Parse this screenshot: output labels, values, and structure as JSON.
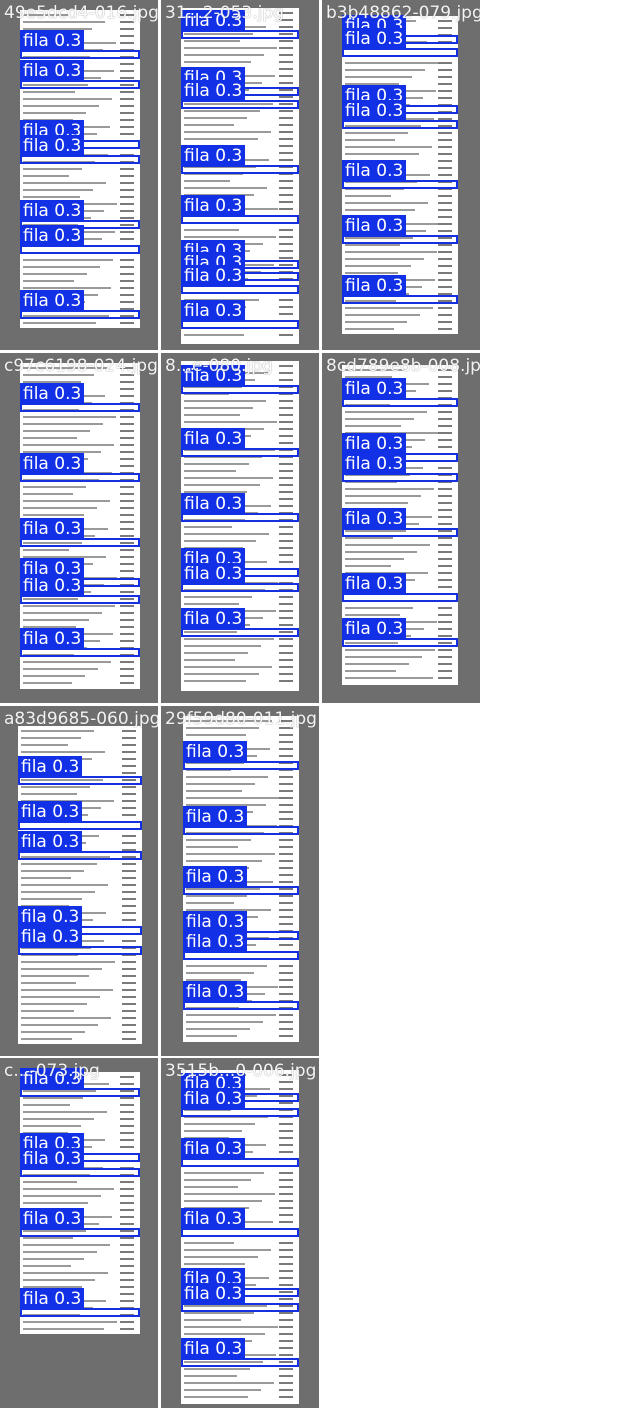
{
  "grid": {
    "background": "#6e6e6e",
    "box_color": "#1430e0",
    "label_color": "#1230e6",
    "tiles": [
      {
        "title": "49e5dcd4-016.jpg",
        "detections": [
          {
            "label": "fila 0.3"
          },
          {
            "label": "fila 0.3"
          },
          {
            "label": "fila 0.3"
          },
          {
            "label": "fila 0.3"
          },
          {
            "label": "fila 0.3"
          },
          {
            "label": "fila 0.3"
          },
          {
            "label": "fila 0.3"
          }
        ]
      },
      {
        "title": "31...2-053.jpg",
        "detections": [
          {
            "label": "fila 0.3"
          },
          {
            "label": "fila 0.3"
          },
          {
            "label": "fila 0.3"
          },
          {
            "label": "fila 0.3"
          },
          {
            "label": "fila 0.3"
          },
          {
            "label": "fila 0.3"
          },
          {
            "label": "fila 0.3"
          },
          {
            "label": "fila 0.3"
          },
          {
            "label": "fila 0.3"
          }
        ]
      },
      {
        "title": "b3b48862-079.jpg",
        "detections": [
          {
            "label": "fila 0.3"
          },
          {
            "label": "fila 0.3"
          },
          {
            "label": "fila 0.3"
          },
          {
            "label": "fila 0.3"
          },
          {
            "label": "fila 0.3"
          },
          {
            "label": "fila 0.3"
          },
          {
            "label": "fila 0.3"
          }
        ]
      },
      {
        "title": "c97c6198-024.jpg",
        "detections": [
          {
            "label": "fila 0.3"
          },
          {
            "label": "fila 0.3"
          },
          {
            "label": "fila 0.3"
          },
          {
            "label": "fila 0.3"
          },
          {
            "label": "fila 0.3"
          },
          {
            "label": "fila 0.3"
          }
        ]
      },
      {
        "title": "8...e-080.jpg",
        "detections": [
          {
            "label": "fila 0.3"
          },
          {
            "label": "fila 0.3"
          },
          {
            "label": "fila 0.3"
          },
          {
            "label": "fila 0.3"
          },
          {
            "label": "fila 0.3"
          },
          {
            "label": "fila 0.3"
          }
        ]
      },
      {
        "title": "8cd789e8b-008.jpg",
        "detections": [
          {
            "label": "fila 0.3"
          },
          {
            "label": "fila 0.3"
          },
          {
            "label": "fila 0.3"
          },
          {
            "label": "fila 0.3"
          },
          {
            "label": "fila 0.3"
          },
          {
            "label": "fila 0.3"
          }
        ]
      },
      {
        "title": "a83d9685-060.jpg",
        "detections": [
          {
            "label": "fila 0.3"
          },
          {
            "label": "fila 0.3"
          },
          {
            "label": "fila 0.3"
          },
          {
            "label": "fila 0.3"
          },
          {
            "label": "fila 0.3"
          }
        ]
      },
      {
        "title": "29f59d80-011.jpg",
        "detections": [
          {
            "label": "fila 0.3"
          },
          {
            "label": "fila 0.3"
          },
          {
            "label": "fila 0.3"
          },
          {
            "label": "fila 0.3"
          },
          {
            "label": "fila 0.3"
          },
          {
            "label": "fila 0.3"
          }
        ]
      },
      {
        "title": "c...-073.jpg",
        "detections": [
          {
            "label": "fila 0.3"
          },
          {
            "label": "fila 0.3"
          },
          {
            "label": "fila 0.3"
          },
          {
            "label": "fila 0.3"
          },
          {
            "label": "fila 0.3"
          }
        ]
      },
      {
        "title": "3515b...0-006.jpg",
        "detections": [
          {
            "label": "fila 0.3"
          },
          {
            "label": "fila 0.3"
          },
          {
            "label": "fila 0.3"
          },
          {
            "label": "fila 0.3"
          },
          {
            "label": "fila 0.3"
          },
          {
            "label": "fila 0.3"
          },
          {
            "label": "fila 0.3"
          }
        ]
      }
    ]
  }
}
